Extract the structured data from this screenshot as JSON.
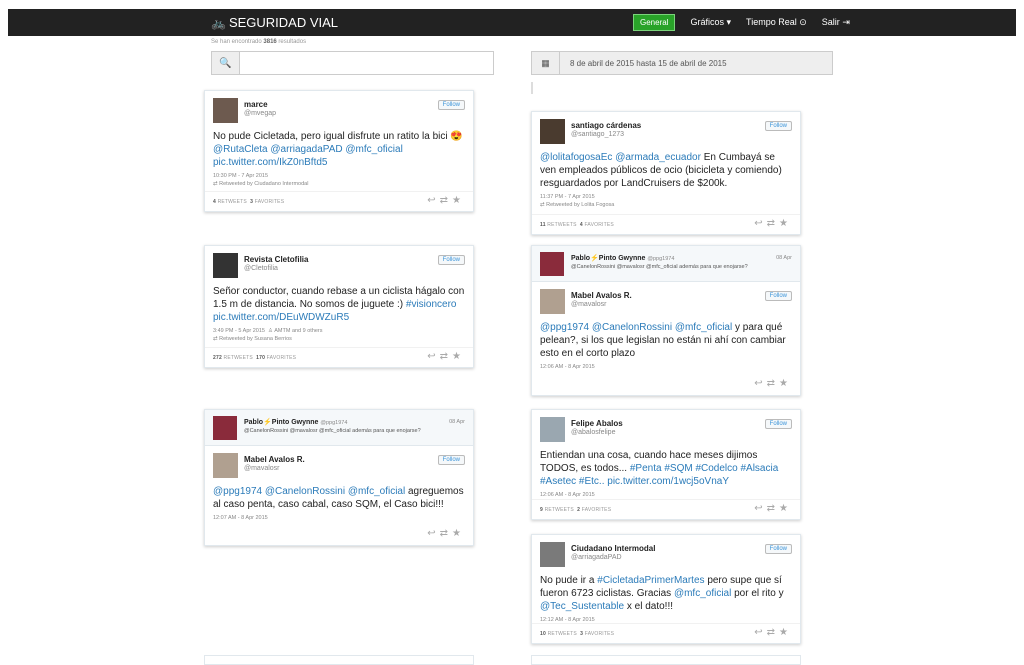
{
  "nav": {
    "brand": "SEGURIDAD VIAL",
    "general": "General",
    "graficos": "Gráficos",
    "tiempo_real": "Tiempo Real",
    "salir": "Salir"
  },
  "results": {
    "prefix": "Se han encontrado",
    "count": "3816",
    "suffix": "resultados"
  },
  "search": {
    "placeholder": ""
  },
  "daterange": {
    "text": "8 de abril de 2015 hasta 15 de abril de 2015"
  },
  "follow_label": "Follow",
  "tweets": {
    "t1": {
      "name": "marce",
      "handle": "@mvegap",
      "text": "No pude Cicletada, pero igual disfrute un ratito la bici 😍",
      "links": "@RutaCleta @arriagadaPAD @mfc_oficial pic.twitter.com/IkZ0nBftd5",
      "meta": "10:30 PM - 7 Apr 2015",
      "retweeted_by": "Retweeted by Ciudadano Intermodal",
      "retweets": "4",
      "favorites": "3"
    },
    "t2": {
      "name": "Revista Cletofilia",
      "handle": "@Cletofilia",
      "text": "Señor conductor,  cuando rebase a un ciclista hágalo con 1.5 m de distancia. No somos de juguete :)",
      "hashtag": "#visioncero",
      "link": "pic.twitter.com/DEuWDWZuR5",
      "meta": "3:49 PM - 5 Apr 2015",
      "tagged": "AMTM and 9 others",
      "retweeted_by": "Retweeted by Susana Berrios",
      "retweets": "272",
      "favorites": "170"
    },
    "t3": {
      "rt_name": "Pablo⚡Pinto Gwynne",
      "rt_handle": "@ppg1974",
      "rt_date": "08 Apr",
      "rt_text": "@CanelonRossini @mavalosr @mfc_oficial además para que enojarse?",
      "name": "Mabel Avalos R.",
      "handle": "@mavalosr",
      "text_links": "@ppg1974 @CanelonRossini @mfc_oficial",
      "text": "agreguemos al caso penta, caso cabal, caso SQM, el Caso bici!!!",
      "meta": "12:07 AM - 8 Apr 2015"
    },
    "t4": {
      "name": "santiago cárdenas",
      "handle": "@santiago_1273",
      "text_links": "@lolitafogosaEc @armada_ecuador",
      "text": "En Cumbayá se ven empleados públicos de ocio (bicicleta y comiendo) resguardados por LandCruisers de $200k.",
      "meta": "11:37 PM - 7 Apr 2015",
      "retweeted_by": "Retweeted by Lolita Fogosa",
      "retweets": "11",
      "favorites": "4"
    },
    "t5": {
      "rt_name": "Pablo⚡Pinto Gwynne",
      "rt_handle": "@ppg1974",
      "rt_date": "08 Apr",
      "rt_text": "@CanelonRossini @mavalosr @mfc_oficial además para que enojarse?",
      "name": "Mabel Avalos R.",
      "handle": "@mavalosr",
      "text_links": "@ppg1974 @CanelonRossini @mfc_oficial",
      "text": "y para qué pelean?, si los que legislan no están ni ahí con cambiar esto en el corto plazo",
      "meta": "12:06 AM - 8 Apr 2015"
    },
    "t6": {
      "name": "Felipe Abalos",
      "handle": "@abalosfelipe",
      "text": "Entiendan una cosa, cuando hace meses dijimos TODOS, es todos...",
      "hashtags": "#Penta #SQM #Codelco #Alsacia #Asetec #Etc..",
      "link": "pic.twitter.com/1wcj5oVnaY",
      "meta": "12:06 AM - 8 Apr 2015",
      "retweets": "9",
      "favorites": "2"
    },
    "t7": {
      "name": "Ciudadano Intermodal",
      "handle": "@arriagadaPAD",
      "text_a": "No pude ir a",
      "hashtag": "#CicletadaPrimerMartes",
      "text_b": "pero supe que sí fueron 6723 ciclistas. Gracias",
      "mention_a": "@mfc_oficial",
      "text_c": "por el rito y",
      "mention_b": "@Tec_Sustentable",
      "text_d": "x el dato!!!",
      "meta": "12:12 AM - 8 Apr 2015",
      "retweets": "10",
      "favorites": "3"
    }
  },
  "labels": {
    "retweets": "RETWEETS",
    "favorites": "FAVORITES"
  }
}
